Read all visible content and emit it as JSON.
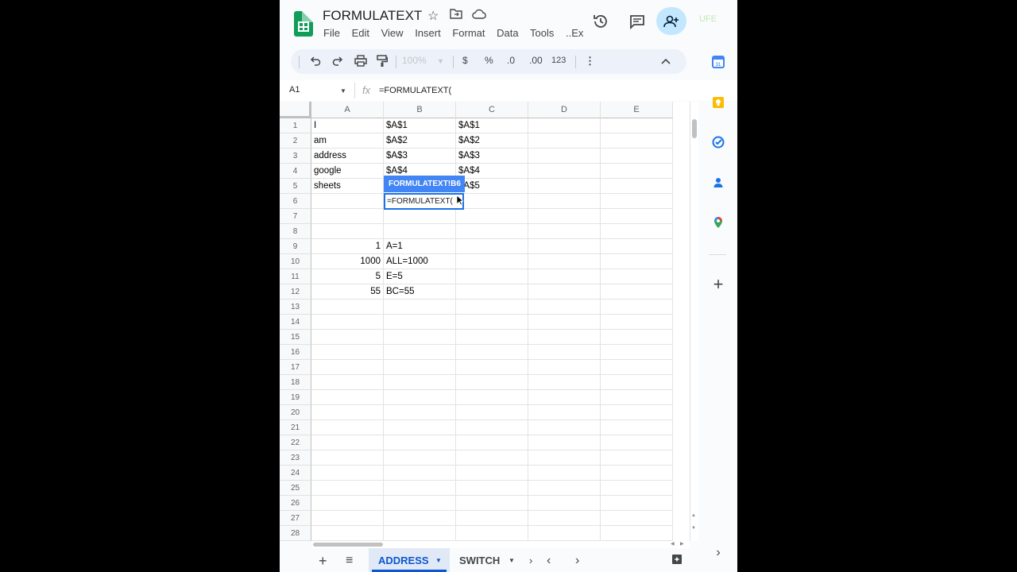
{
  "doc": {
    "title": "FORMULATEXT"
  },
  "menu": [
    "File",
    "Edit",
    "View",
    "Insert",
    "Format",
    "Data",
    "Tools",
    "..Ex"
  ],
  "toolbar": {
    "zoom": "100%",
    "currency": "$",
    "percent": "%",
    "dec_decrease": ".0",
    "dec_increase": ".00",
    "number_format": "123"
  },
  "formula_bar": {
    "namebox": "A1",
    "fx": "fx",
    "formula": "=FORMULATEXT("
  },
  "columns": [
    "A",
    "B",
    "C",
    "D",
    "E"
  ],
  "rows": [
    "1",
    "2",
    "3",
    "4",
    "5",
    "6",
    "7",
    "8",
    "9",
    "10",
    "11",
    "12",
    "13",
    "14",
    "15",
    "16",
    "17",
    "18",
    "19",
    "20",
    "21",
    "22",
    "23",
    "24",
    "25",
    "26",
    "27",
    "28"
  ],
  "cells": {
    "a1": "I",
    "b1": "$A$1",
    "c1": "$A$1",
    "a2": "am",
    "b2": "$A$2",
    "c2": "$A$2",
    "a3": "address",
    "b3": "$A$3",
    "c3": "$A$3",
    "a4": "google",
    "b4": "$A$4",
    "c4": "$A$4",
    "a5": "sheets",
    "c5": "$A$5",
    "a9": "1",
    "b9": "A=1",
    "a10": "1000",
    "b10": "ALL=1000",
    "a11": "5",
    "b11": "E=5",
    "a12": "55",
    "b12": "BC=55"
  },
  "active_cell": {
    "text": "=FORMULATEXT(",
    "chip": "FORMULATEXT!B6"
  },
  "sheets": [
    {
      "label": "ADDRESS",
      "active": true
    },
    {
      "label": "SWITCH",
      "active": false
    }
  ],
  "user_initials": "UFE",
  "colors": {
    "accent": "#1a73e8",
    "chip": "#4285f4",
    "share_bg": "#c2e7ff",
    "brand": "#0f9d58"
  }
}
